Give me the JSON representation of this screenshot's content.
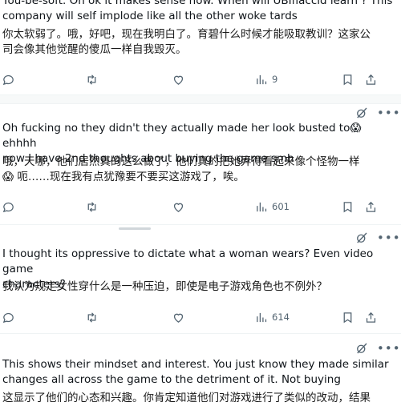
{
  "tweets": [
    {
      "text": "You-be-soft.  Oh ok it makes sense now. When will UBIfiaccid learn ? This\ncompany will self implode like all the other woke tards",
      "translation": "你太软弱了。哦，好吧，现在我明白了。育碧什么时候才能吸取教训？这家公\n司会像其他觉醒的傻瓜一样自我毁灭。",
      "views": "9"
    },
    {
      "text": "Oh fucking no they didn't they actually made her look busted to😱 ehhhh\nnow I have 2nd thoughts about buying the game smh",
      "translation": "哦，天哪，他们居然真的这么做了，他们真的把她弄得看起来像个怪物一样\n😱 呃……现在我有点犹豫要不要买这游戏了，唉。",
      "views": "601"
    },
    {
      "text": "I thought its oppressive to dictate what a woman wears? Even video game\ncharacters?",
      "translation": "我认为规定女性穿什么是一种压迫，即使是电子游戏角色也不例外？",
      "views": "614"
    },
    {
      "text": "This shows their mindset and interest.  You just know they made similar\nchanges all across the game to the detriment of it. Not buying",
      "translation": "这显示了他们的心态和兴趣。你肯定知道他们对游戏进行了类似的改动，结果"
    }
  ],
  "icons": {
    "reply": "reply-icon",
    "retweet": "retweet-icon",
    "like": "heart-icon",
    "views": "views-icon",
    "bookmark": "bookmark-icon",
    "share": "share-icon",
    "grok": "grok-icon",
    "more": "more-icon"
  },
  "colors": {
    "text": "#0f1419",
    "muted": "#536471",
    "divider": "#eff3f4"
  }
}
